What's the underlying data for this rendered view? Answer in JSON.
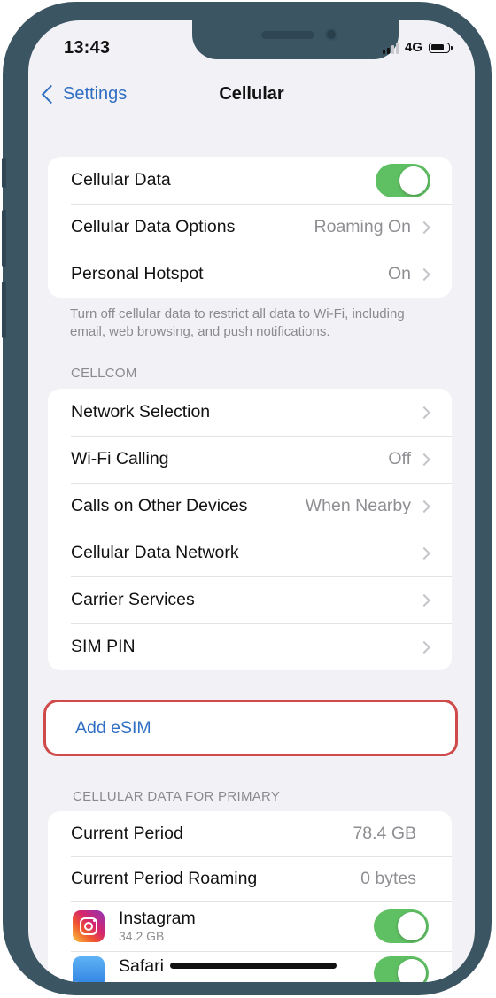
{
  "status_bar": {
    "time": "13:43",
    "network": "4G",
    "battery_percent": 80,
    "signal_bars_active": 2,
    "signal_bars_total": 4
  },
  "nav": {
    "back_label": "Settings",
    "title": "Cellular"
  },
  "data_group": {
    "rows": [
      {
        "label": "Cellular Data",
        "toggle_on": true
      },
      {
        "label": "Cellular Data Options",
        "value": "Roaming On"
      },
      {
        "label": "Personal Hotspot",
        "value": "On"
      }
    ],
    "footer": "Turn off cellular data to restrict all data to Wi-Fi, including email, web browsing, and push notifications."
  },
  "carrier_section": {
    "header": "CELLCOM",
    "rows": [
      {
        "label": "Network Selection",
        "value": ""
      },
      {
        "label": "Wi-Fi Calling",
        "value": "Off"
      },
      {
        "label": "Calls on Other Devices",
        "value": "When Nearby"
      },
      {
        "label": "Cellular Data Network",
        "value": ""
      },
      {
        "label": "Carrier Services",
        "value": ""
      },
      {
        "label": "SIM PIN",
        "value": ""
      }
    ]
  },
  "esim": {
    "label": "Add eSIM",
    "highlight_color": "#cf4b4b"
  },
  "usage_section": {
    "header": "CELLULAR DATA FOR PRIMARY",
    "rows": [
      {
        "label": "Current Period",
        "value": "78.4 GB"
      },
      {
        "label": "Current Period Roaming",
        "value": "0 bytes"
      }
    ],
    "apps": [
      {
        "name": "Instagram",
        "size": "34.2 GB",
        "icon": "instagram-icon",
        "toggle_on": true
      },
      {
        "name": "Safari",
        "icon": "safari-icon",
        "toggle_on": true
      }
    ]
  },
  "colors": {
    "accent": "#2f6ec2",
    "toggle_on": "#5fbf63",
    "frame": "#3b5563",
    "background": "#f2f2f6"
  }
}
